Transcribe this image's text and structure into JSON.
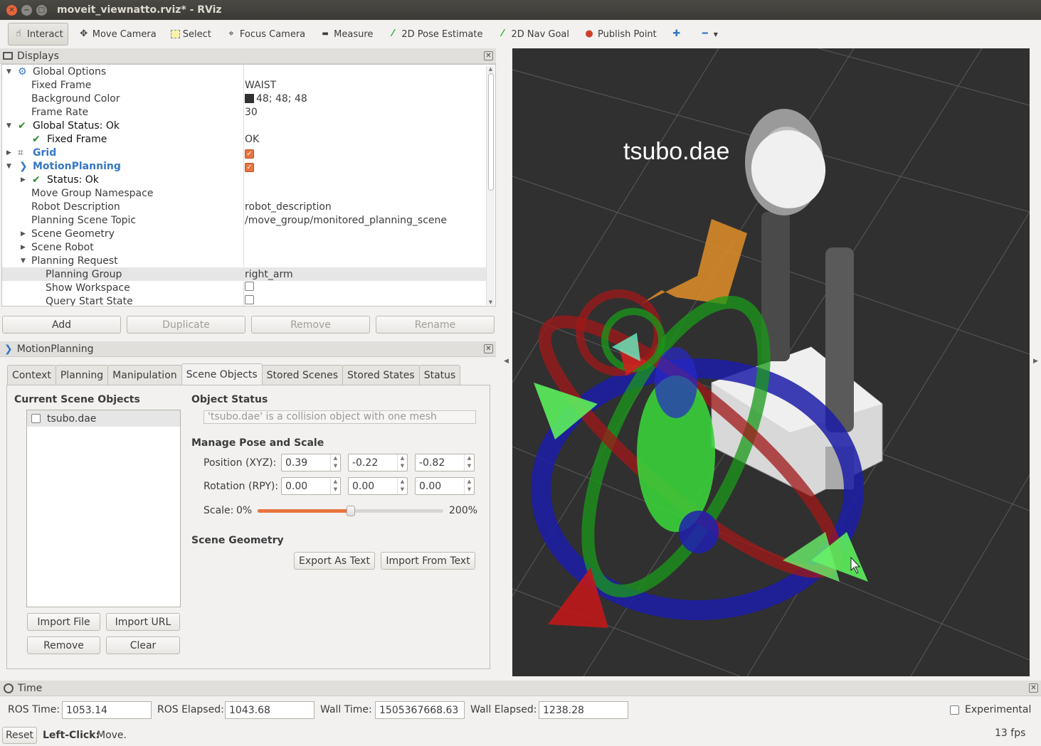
{
  "window": {
    "title": "moveit_viewnatto.rviz* - RViz"
  },
  "toolbar": {
    "tools": [
      {
        "label": "Interact",
        "icon": "hand-icon"
      },
      {
        "label": "Move Camera",
        "icon": "move-camera-icon"
      },
      {
        "label": "Select",
        "icon": "select-icon"
      },
      {
        "label": "Focus Camera",
        "icon": "focus-camera-icon"
      },
      {
        "label": "Measure",
        "icon": "ruler-icon"
      },
      {
        "label": "2D Pose Estimate",
        "icon": "green-arrow-icon"
      },
      {
        "label": "2D Nav Goal",
        "icon": "green-arrow-icon"
      },
      {
        "label": "Publish Point",
        "icon": "map-pin-icon"
      }
    ]
  },
  "displays": {
    "title": "Displays",
    "rows": {
      "global_options": "Global Options",
      "fixed_frame_k": "Fixed Frame",
      "fixed_frame_v": "WAIST",
      "bg_color_k": "Background Color",
      "bg_color_v": "48; 48; 48",
      "frame_rate_k": "Frame Rate",
      "frame_rate_v": "30",
      "global_status": "Global Status: Ok",
      "fixed_frame_status_k": "Fixed Frame",
      "fixed_frame_status_v": "OK",
      "grid": "Grid",
      "motion_planning": "MotionPlanning",
      "status_ok": "Status: Ok",
      "move_group_ns": "Move Group Namespace",
      "robot_desc_k": "Robot Description",
      "robot_desc_v": "robot_description",
      "planning_scene_topic_k": "Planning Scene Topic",
      "planning_scene_topic_v": "/move_group/monitored_planning_scene",
      "scene_geometry": "Scene Geometry",
      "scene_robot": "Scene Robot",
      "planning_request": "Planning Request",
      "planning_group_k": "Planning Group",
      "planning_group_v": "right_arm",
      "show_workspace": "Show Workspace",
      "query_start_state": "Query Start State"
    },
    "buttons": {
      "add": "Add",
      "duplicate": "Duplicate",
      "remove": "Remove",
      "rename": "Rename"
    }
  },
  "motion_planning": {
    "title": "MotionPlanning",
    "tabs": [
      "Context",
      "Planning",
      "Manipulation",
      "Scene Objects",
      "Stored Scenes",
      "Stored States",
      "Status"
    ],
    "current_scene_objects": "Current Scene Objects",
    "objects": [
      "tsubo.dae"
    ],
    "object_status_label": "Object Status",
    "object_status_text": "'tsubo.dae' is a collision object with one mesh",
    "manage_pose_label": "Manage Pose and Scale",
    "position_label": "Position (XYZ):",
    "position": [
      "0.39",
      "-0.22",
      "-0.82"
    ],
    "rotation_label": "Rotation (RPY):",
    "rotation": [
      "0.00",
      "0.00",
      "0.00"
    ],
    "scale_label": "Scale:",
    "scale_min": "0%",
    "scale_max": "200%",
    "scale_value": 0.5,
    "scene_geometry_label": "Scene Geometry",
    "export_btn": "Export As Text",
    "import_text_btn": "Import From Text",
    "import_file_btn": "Import File",
    "import_url_btn": "Import URL",
    "remove_btn": "Remove",
    "clear_btn": "Clear"
  },
  "viewport": {
    "label": "tsubo.dae",
    "background": "#303030"
  },
  "time": {
    "title": "Time",
    "ros_time_label": "ROS Time:",
    "ros_time": "1053.14",
    "ros_elapsed_label": "ROS Elapsed:",
    "ros_elapsed": "1043.68",
    "wall_time_label": "Wall Time:",
    "wall_time": "1505367668.63",
    "wall_elapsed_label": "Wall Elapsed:",
    "wall_elapsed": "1238.28",
    "experimental_label": "Experimental"
  },
  "status": {
    "reset": "Reset",
    "hint_bold": "Left-Click:",
    "hint": "Move.",
    "fps": "13 fps"
  }
}
